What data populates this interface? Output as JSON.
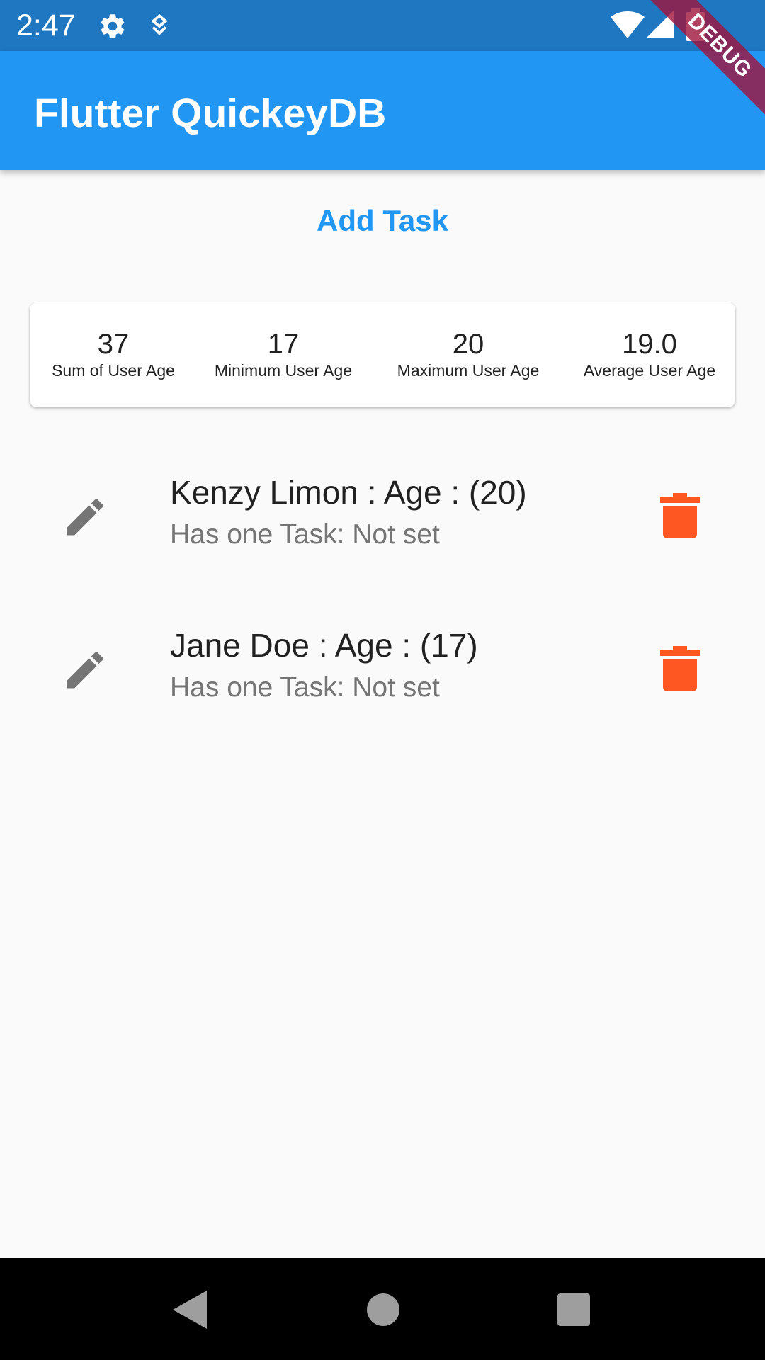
{
  "status_bar": {
    "time": "2:47",
    "icons": [
      "gear-icon",
      "location-icon",
      "wifi-icon",
      "signal-icon",
      "battery-icon"
    ]
  },
  "app_bar": {
    "title": "Flutter QuickeyDB",
    "color": "#2196f3",
    "debug_label": "DEBUG"
  },
  "actions": {
    "add_task_label": "Add Task",
    "color": "#2196f3"
  },
  "stats": [
    {
      "value": "37",
      "label": "Sum of User Age"
    },
    {
      "value": "17",
      "label": "Minimum User Age"
    },
    {
      "value": "20",
      "label": "Maximum User Age"
    },
    {
      "value": "19.0",
      "label": "Average User Age"
    }
  ],
  "users": [
    {
      "title": "Kenzy Limon : Age : (20)",
      "subtitle": "Has one Task: Not set"
    },
    {
      "title": "Jane Doe : Age : (17)",
      "subtitle": "Has one Task: Not set"
    }
  ],
  "icons": {
    "edit": "edit-icon",
    "delete": "trash-icon",
    "delete_color": "#ff5722",
    "edit_color": "#757575"
  },
  "nav_bar": {
    "buttons": [
      "back-icon",
      "home-icon",
      "recent-apps-icon"
    ]
  }
}
